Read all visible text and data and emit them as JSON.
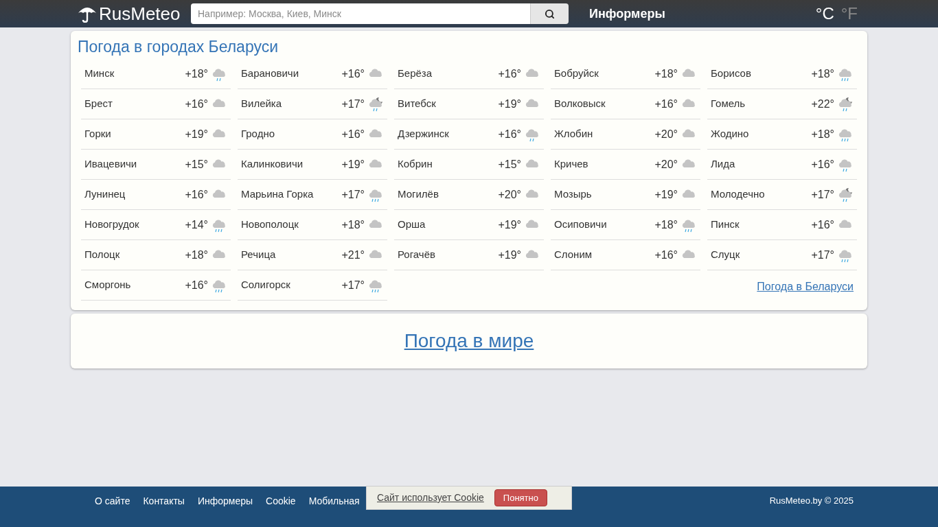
{
  "header": {
    "logo": "RusMeteo",
    "search": {
      "placeholder": "Например: Москва, Киев, Минск"
    },
    "nav": "Информеры",
    "units": [
      {
        "label": "°C",
        "selected": true
      },
      {
        "label": "°F",
        "selected": false
      }
    ]
  },
  "cities": {
    "title": "Погода в городах Беларуси",
    "items": [
      {
        "name": "Минск",
        "temp": "+18°",
        "kind": "rain"
      },
      {
        "name": "Барановичи",
        "temp": "+16°",
        "kind": "cloud"
      },
      {
        "name": "Берёза",
        "temp": "+16°",
        "kind": "cloud"
      },
      {
        "name": "Бобруйск",
        "temp": "+18°",
        "kind": "cloud"
      },
      {
        "name": "Борисов",
        "temp": "+18°",
        "kind": "heavy-rain"
      },
      {
        "name": "Брест",
        "temp": "+16°",
        "kind": "cloud"
      },
      {
        "name": "Вилейка",
        "temp": "+17°",
        "kind": "night-rain"
      },
      {
        "name": "Витебск",
        "temp": "+19°",
        "kind": "cloud"
      },
      {
        "name": "Волковыск",
        "temp": "+16°",
        "kind": "cloud"
      },
      {
        "name": "Гомель",
        "temp": "+22°",
        "kind": "night-rain"
      },
      {
        "name": "Горки",
        "temp": "+19°",
        "kind": "cloud"
      },
      {
        "name": "Гродно",
        "temp": "+16°",
        "kind": "cloud"
      },
      {
        "name": "Дзержинск",
        "temp": "+16°",
        "kind": "rain"
      },
      {
        "name": "Жлобин",
        "temp": "+20°",
        "kind": "cloud"
      },
      {
        "name": "Жодино",
        "temp": "+18°",
        "kind": "heavy-rain"
      },
      {
        "name": "Ивацевичи",
        "temp": "+15°",
        "kind": "cloud"
      },
      {
        "name": "Калинковичи",
        "temp": "+19°",
        "kind": "cloud"
      },
      {
        "name": "Кобрин",
        "temp": "+15°",
        "kind": "cloud"
      },
      {
        "name": "Кричев",
        "temp": "+20°",
        "kind": "cloud"
      },
      {
        "name": "Лида",
        "temp": "+16°",
        "kind": "rain"
      },
      {
        "name": "Лунинец",
        "temp": "+16°",
        "kind": "cloud"
      },
      {
        "name": "Марьина Горка",
        "temp": "+17°",
        "kind": "heavy-rain"
      },
      {
        "name": "Могилёв",
        "temp": "+20°",
        "kind": "cloud"
      },
      {
        "name": "Мозырь",
        "temp": "+19°",
        "kind": "cloud"
      },
      {
        "name": "Молодечно",
        "temp": "+17°",
        "kind": "night-rain"
      },
      {
        "name": "Новогрудок",
        "temp": "+14°",
        "kind": "heavy-rain"
      },
      {
        "name": "Новополоцк",
        "temp": "+18°",
        "kind": "cloud"
      },
      {
        "name": "Орша",
        "temp": "+19°",
        "kind": "cloud"
      },
      {
        "name": "Осиповичи",
        "temp": "+18°",
        "kind": "heavy-rain"
      },
      {
        "name": "Пинск",
        "temp": "+16°",
        "kind": "cloud"
      },
      {
        "name": "Полоцк",
        "temp": "+18°",
        "kind": "cloud"
      },
      {
        "name": "Речица",
        "temp": "+21°",
        "kind": "cloud"
      },
      {
        "name": "Рогачёв",
        "temp": "+19°",
        "kind": "cloud"
      },
      {
        "name": "Слоним",
        "temp": "+16°",
        "kind": "cloud"
      },
      {
        "name": "Слуцк",
        "temp": "+17°",
        "kind": "heavy-rain"
      },
      {
        "name": "Сморгонь",
        "temp": "+16°",
        "kind": "heavy-rain"
      },
      {
        "name": "Солигорск",
        "temp": "+17°",
        "kind": "heavy-rain"
      }
    ],
    "more_link": "Погода в Беларуси"
  },
  "world_link": "Погода в мире",
  "footer": {
    "links": [
      "О сайте",
      "Контакты",
      "Информеры",
      "Cookie",
      "Мобильная"
    ],
    "copyright": "RusMeteo.by © 2025"
  },
  "cookie_banner": {
    "text": "Сайт использует Cookie",
    "button": "Понятно"
  }
}
